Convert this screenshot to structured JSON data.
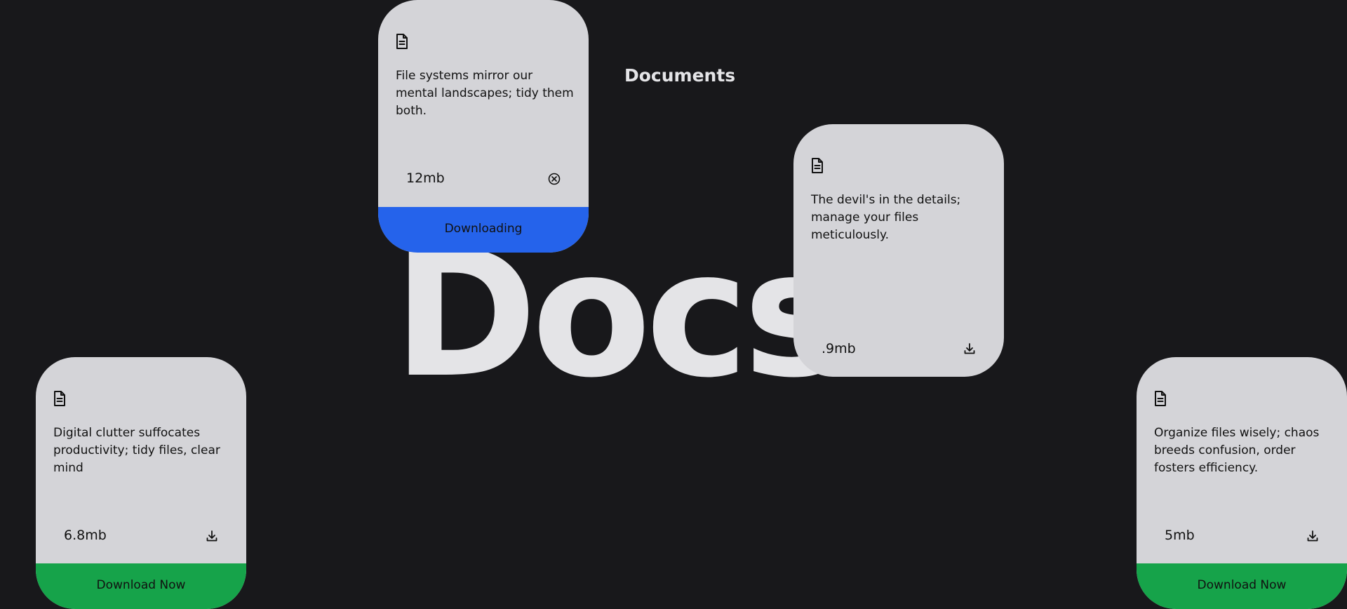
{
  "header": {
    "title": "Documents",
    "backdrop_word": "Docs."
  },
  "colors": {
    "background": "#18181b",
    "card": "#d4d4d8",
    "downloading": "#2563eb",
    "download_now": "#16a34a",
    "text_light": "#e4e4e7"
  },
  "cards": [
    {
      "icon": "document-icon",
      "text": "File systems mirror our mental landscapes; tidy them both.",
      "size": "12mb",
      "action_icon": "close-circle-icon",
      "button_label": "Downloading"
    },
    {
      "icon": "document-icon",
      "text": "The devil's in the details; manage your files meticulously.",
      "size": ".9mb",
      "action_icon": "download-icon"
    },
    {
      "icon": "document-icon",
      "text": "Digital clutter suffocates productivity; tidy files, clear mind",
      "size": "6.8mb",
      "action_icon": "download-icon",
      "button_label": "Download Now"
    },
    {
      "icon": "document-icon",
      "text": "Organize files wisely; chaos breeds confusion, order fosters efficiency.",
      "size": "5mb",
      "action_icon": "download-icon",
      "button_label": "Download Now"
    }
  ]
}
